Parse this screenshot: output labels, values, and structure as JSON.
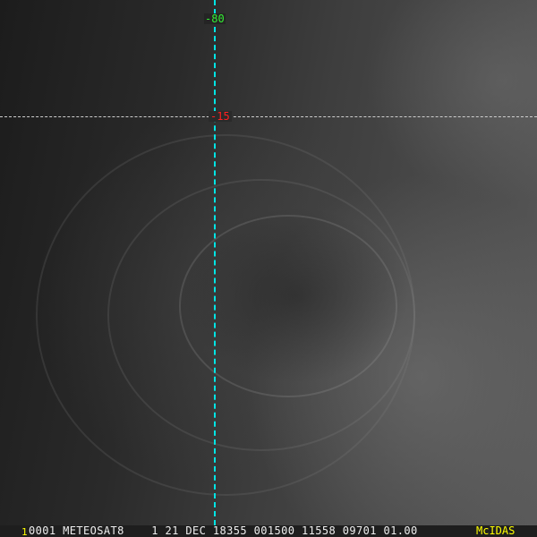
{
  "overlay": {
    "longitude_label": "-80",
    "latitude_label": "-15",
    "longitude_line_color": "#00e5e5",
    "latitude_line_color": "#cfcfcf"
  },
  "status_bar": {
    "frame_number": "1",
    "info": "0001 METEOSAT8    1 21 DEC 18355 001500 11558 09701 01.00",
    "brand": "McIDAS"
  }
}
